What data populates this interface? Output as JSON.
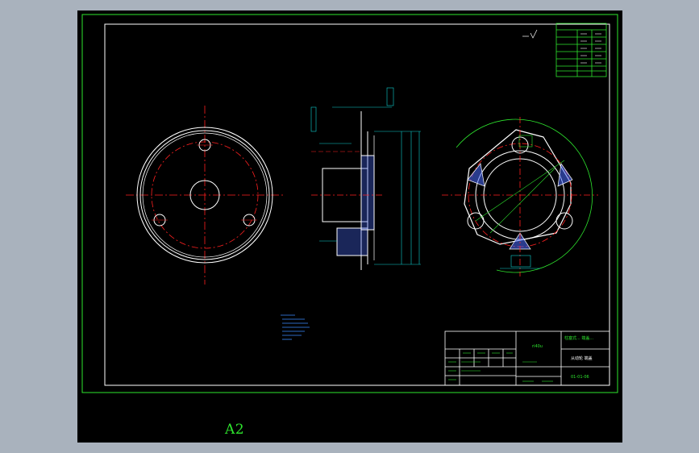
{
  "drawing": {
    "sheet_size_label": "A2",
    "material_note": "ri40u",
    "title_block": {
      "drawing_title": "柱塞式... 端盖...",
      "part_name": "从动轮 端盖",
      "drawing_code": "01-01-06"
    },
    "colors": {
      "background": "#000000",
      "frame": "#2ee62e",
      "outline": "#ffffff",
      "centerline": "#ff2020",
      "dimension": "#10d0d0",
      "note_text": "#3a8cff",
      "hatch": "#4a6cff"
    }
  }
}
